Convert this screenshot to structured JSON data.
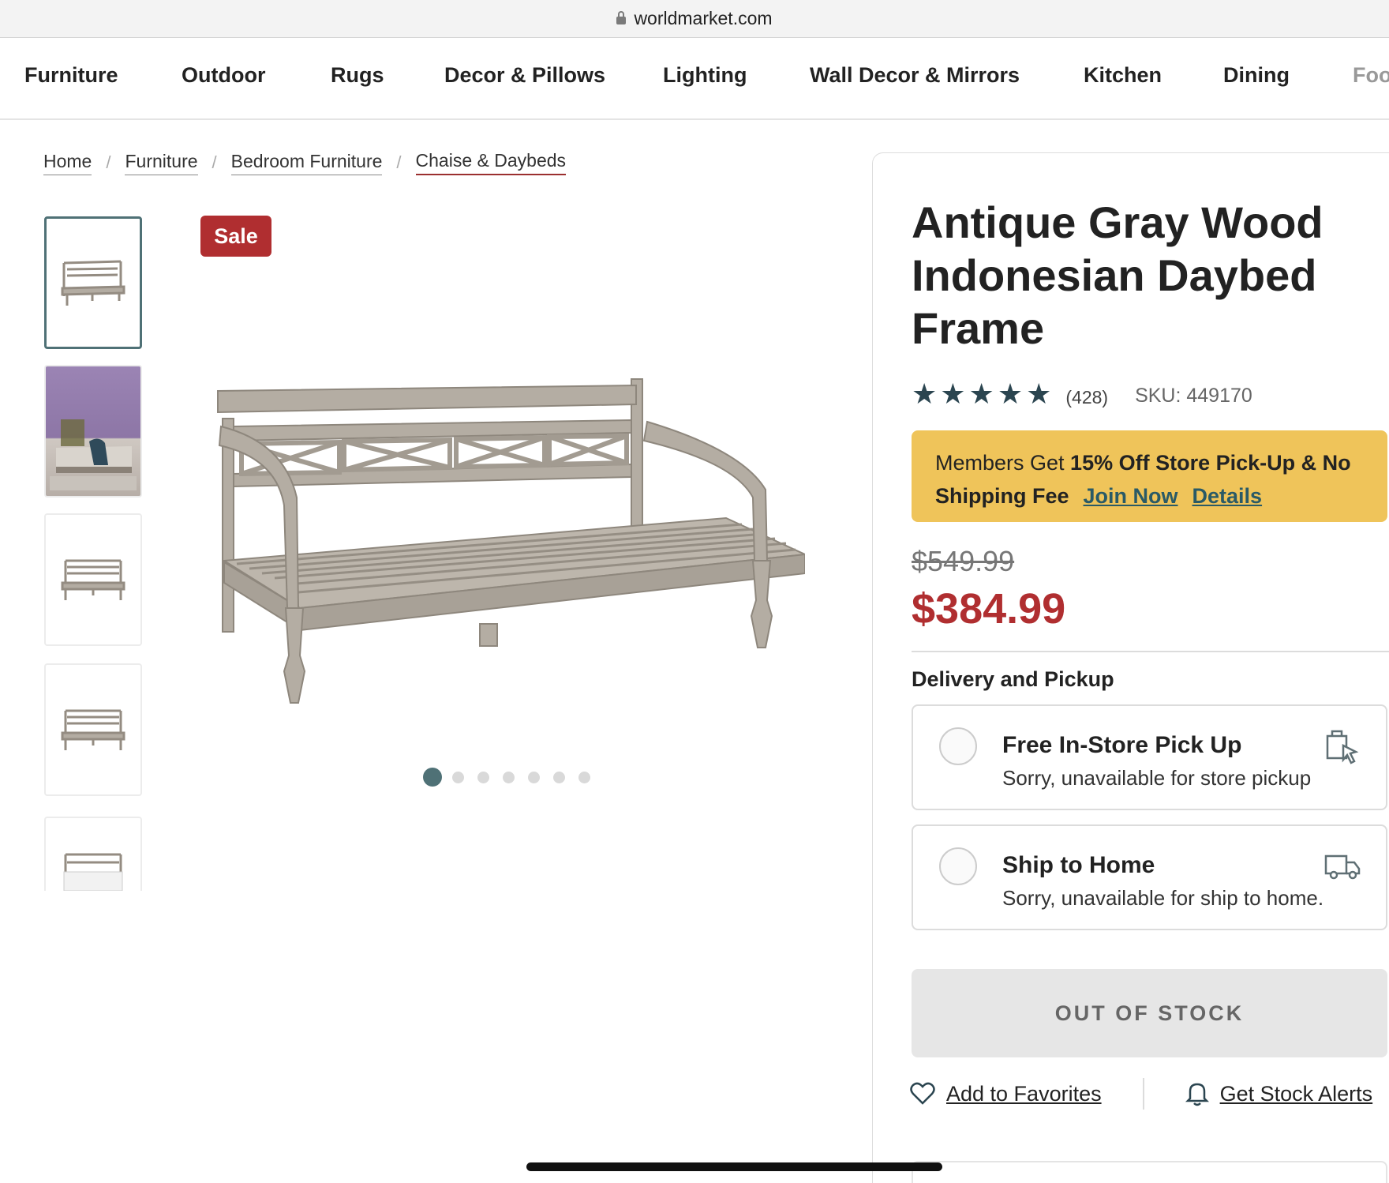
{
  "browser": {
    "url": "worldmarket.com"
  },
  "nav": {
    "items": [
      "Furniture",
      "Outdoor",
      "Rugs",
      "Decor & Pillows",
      "Lighting",
      "Wall Decor & Mirrors",
      "Kitchen",
      "Dining",
      "Foo"
    ]
  },
  "breadcrumb": {
    "items": [
      "Home",
      "Furniture",
      "Bedroom Furniture",
      "Chaise & Daybeds"
    ]
  },
  "gallery": {
    "badge": "Sale",
    "thumbnail_count": 5,
    "dot_count": 7,
    "active_dot": 1
  },
  "product": {
    "title": "Antique Gray Wood Indonesian Daybed Frame",
    "rating": 4.5,
    "rating_stars": "★★★★★",
    "review_count": "(428)",
    "sku": "SKU: 449170",
    "promo": {
      "text_pre": "Members Get ",
      "text_bold": "15% Off Store Pick-Up & No Shipping Fee",
      "join_link": "Join Now",
      "details_link": "Details"
    },
    "original_price": "$549.99",
    "sale_price": "$384.99"
  },
  "delivery": {
    "heading": "Delivery and Pickup",
    "options": [
      {
        "title": "Free In-Store Pick Up",
        "subtitle": "Sorry, unavailable for store pickup",
        "icon": "store-pickup-icon"
      },
      {
        "title": "Ship to Home",
        "subtitle": "Sorry, unavailable for ship to home.",
        "icon": "truck-icon"
      }
    ]
  },
  "cta": {
    "label": "OUT OF STOCK"
  },
  "actions": {
    "favorites": "Add to Favorites",
    "alerts": "Get Stock Alerts"
  },
  "colors": {
    "sale_red": "#b02e30",
    "promo_yellow": "#efc45a",
    "teal": "#4f7176",
    "link_teal": "#2a5a66"
  }
}
